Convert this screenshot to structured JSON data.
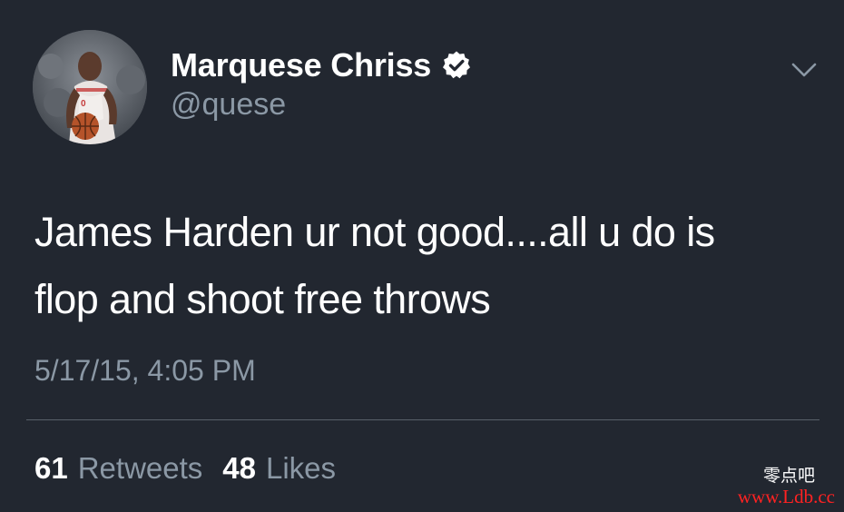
{
  "author": {
    "display_name": "Marquese Chriss",
    "handle": "@quese",
    "verified": true,
    "avatar_icon": "player-photo-avatar"
  },
  "tweet": {
    "text": "James Harden ur not good....all u do is\nflop and shoot free throws",
    "timestamp": "5/17/15, 4:05 PM"
  },
  "stats": {
    "retweets_count": "61",
    "retweets_label": "Retweets",
    "likes_count": "48",
    "likes_label": "Likes"
  },
  "icons": {
    "verified": "verified-badge-icon",
    "menu": "chevron-down-icon"
  },
  "watermark": {
    "chinese": "零点吧",
    "url": "www.Ldb.cc"
  },
  "colors": {
    "background": "#222730",
    "primary_text": "#ffffff",
    "secondary_text": "#8b98a5",
    "divider": "#596069",
    "watermark_url": "#ff2222"
  }
}
